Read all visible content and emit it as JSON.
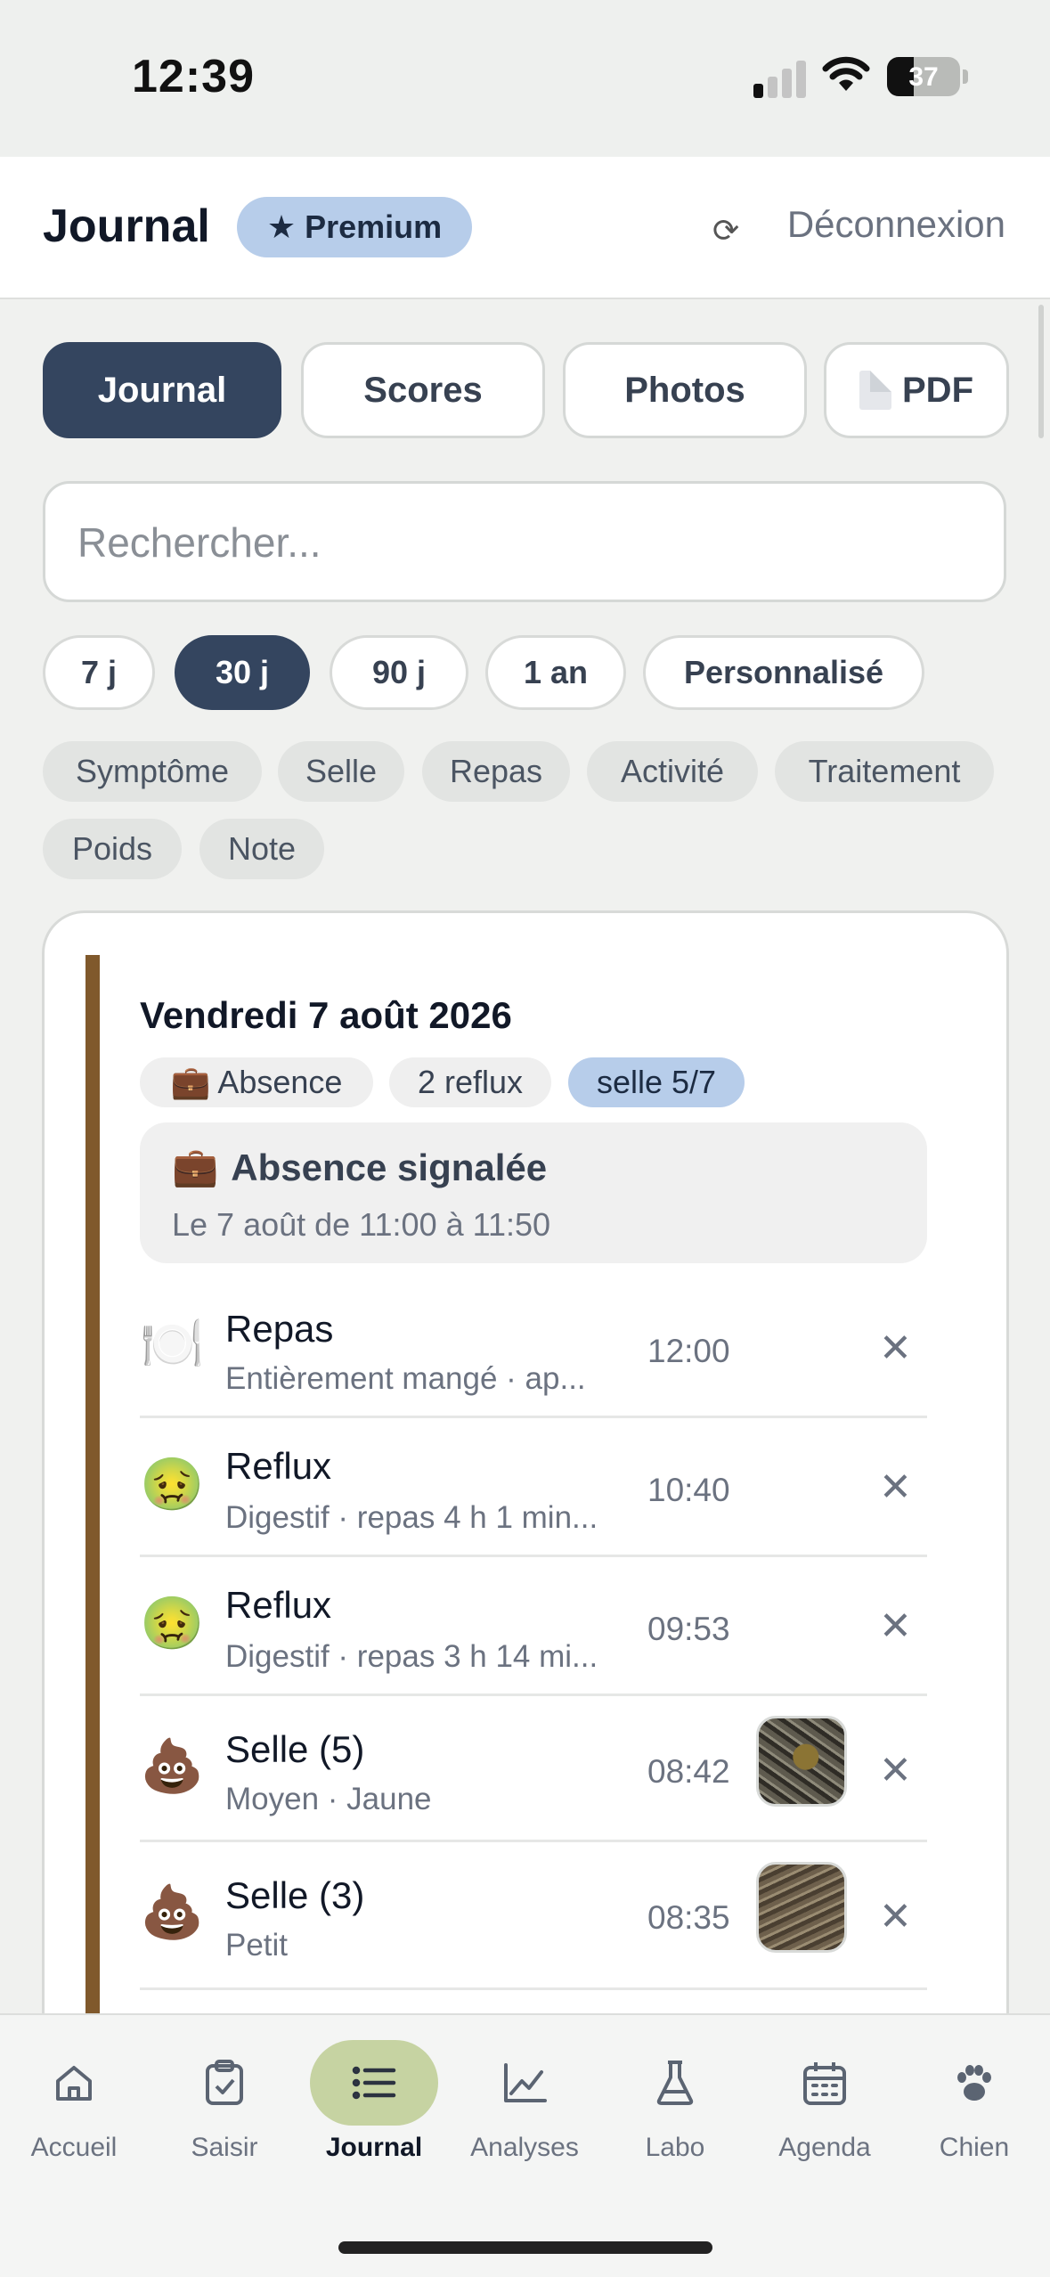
{
  "status_bar": {
    "time": "12:39",
    "battery": "37",
    "battery_level": 0.37
  },
  "header": {
    "title": "Journal",
    "badge": "Premium",
    "logout": "Déconnexion"
  },
  "segments": [
    {
      "label": "Journal",
      "active": true
    },
    {
      "label": "Scores",
      "active": false
    },
    {
      "label": "Photos",
      "active": false
    },
    {
      "label": "PDF",
      "active": false
    }
  ],
  "search": {
    "placeholder": "Rechercher..."
  },
  "ranges": [
    {
      "label": "7 j",
      "active": false
    },
    {
      "label": "30 j",
      "active": true
    },
    {
      "label": "90 j",
      "active": false
    },
    {
      "label": "1 an",
      "active": false
    },
    {
      "label": "Personnalisé",
      "active": false
    }
  ],
  "types": [
    "Symptôme",
    "Selle",
    "Repas",
    "Activité",
    "Traitement",
    "Poids",
    "Note"
  ],
  "day": {
    "title": "Vendredi 7 août 2026",
    "tags": [
      "Absence",
      "2 reflux",
      "selle 5/7"
    ],
    "absence": {
      "title": "Absence signalée",
      "subtitle": "Le 7 août de 11:00 à 11:50"
    },
    "entries": [
      {
        "icon": "plate-icon",
        "emoji": "🍽️",
        "name": "Repas",
        "detail": "Entièrement mangé · ap...",
        "time": "12:00",
        "photo": false
      },
      {
        "icon": "nauseated-face-icon",
        "emoji": "🤢",
        "name": "Reflux",
        "detail": "Digestif · repas 4 h 1 min...",
        "time": "10:40",
        "photo": false
      },
      {
        "icon": "nauseated-face-icon",
        "emoji": "🤢",
        "name": "Reflux",
        "detail": "Digestif · repas 3 h 14 mi...",
        "time": "09:53",
        "photo": false
      },
      {
        "icon": "poop-icon",
        "emoji": "💩",
        "name": "Selle (5)",
        "detail": "Moyen · Jaune",
        "time": "08:42",
        "photo": true
      },
      {
        "icon": "poop-icon",
        "emoji": "💩",
        "name": "Selle (3)",
        "detail": "Petit",
        "time": "08:35",
        "photo": true
      }
    ]
  },
  "tabs": [
    {
      "label": "Accueil",
      "icon": "home-icon",
      "active": false
    },
    {
      "label": "Saisir",
      "icon": "clipboard-check-icon",
      "active": false
    },
    {
      "label": "Journal",
      "icon": "list-icon",
      "active": true
    },
    {
      "label": "Analyses",
      "icon": "chart-line-icon",
      "active": false
    },
    {
      "label": "Labo",
      "icon": "flask-icon",
      "active": false
    },
    {
      "label": "Agenda",
      "icon": "calendar-icon",
      "active": false
    },
    {
      "label": "Chien",
      "icon": "paw-icon",
      "active": false
    }
  ],
  "colors": {
    "accent": "#34455f",
    "premium": "#b7cdea",
    "active_tab": "#c6d3a2",
    "day_bar": "#80592c"
  }
}
